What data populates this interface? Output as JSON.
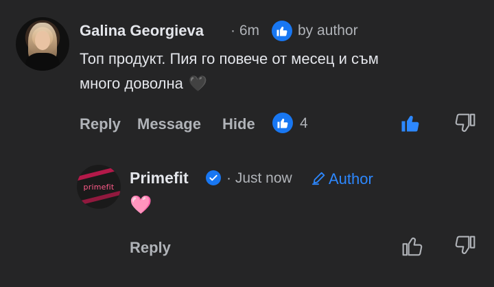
{
  "comment": {
    "author": "Galina Georgieva",
    "time": "· 6m",
    "liked_by": "by author",
    "text_line1": "Топ продукт. Пия го повече от месец и съм",
    "text_line2": "много доволна",
    "emoji": "🖤",
    "actions": {
      "reply": "Reply",
      "message": "Message",
      "hide": "Hide"
    },
    "reaction_count": "4"
  },
  "reply": {
    "author": "Primefit",
    "avatar_text": "primefit",
    "time": "· Just now",
    "author_badge": "Author",
    "text": "🩷",
    "actions": {
      "reply": "Reply"
    }
  },
  "colors": {
    "background": "#252526",
    "accent": "#1877f2",
    "author_badge": "#2d88ff",
    "muted": "#b0b3b8"
  }
}
